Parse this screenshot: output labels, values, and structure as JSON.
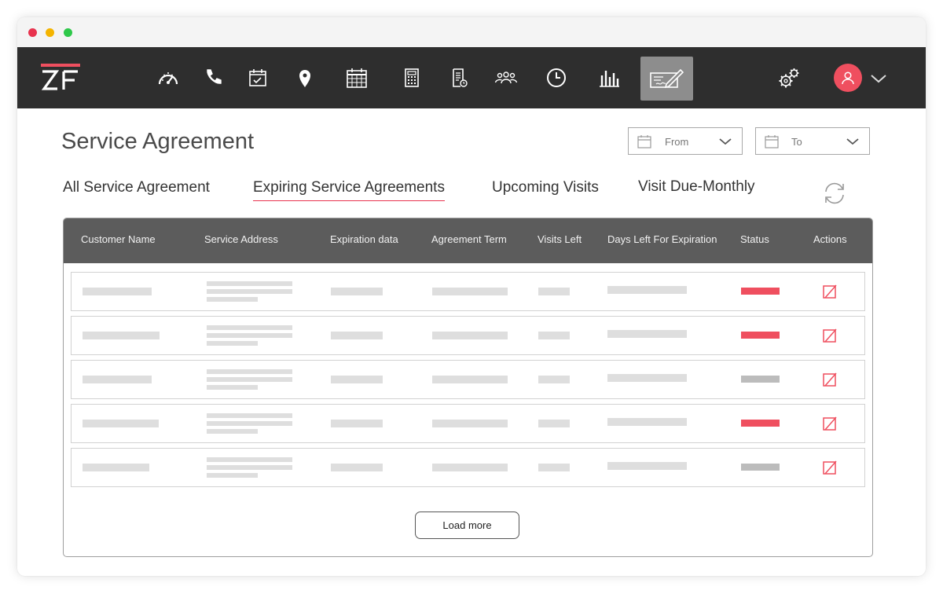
{
  "app": {
    "logo_text": "ZF"
  },
  "nav": {
    "icons": [
      "dashboard-gauge-icon",
      "phone-icon",
      "calendar-check-icon",
      "location-pin-icon",
      "calendar-grid-icon",
      "calculator-icon",
      "invoice-icon",
      "team-icon",
      "clock-icon",
      "bar-chart-icon",
      "service-agreement-icon"
    ],
    "active": "service-agreement-icon",
    "settings_icon": "gears-icon",
    "avatar_icon": "user-icon"
  },
  "page": {
    "title": "Service Agreement",
    "filters": {
      "from_label": "From",
      "to_label": "To"
    }
  },
  "tabs": [
    {
      "label": "All Service Agreement",
      "active": false
    },
    {
      "label": "Expiring Service Agreements",
      "active": true
    },
    {
      "label": "Upcoming Visits",
      "active": false
    },
    {
      "label": "Visit Due-Monthly",
      "active": false
    }
  ],
  "table": {
    "columns": [
      "Customer Name",
      "Service Address",
      "Expiration data",
      "Agreement Term",
      "Visits Left",
      "Days Left For Expiration",
      "Status",
      "Actions"
    ],
    "row_status": [
      "red",
      "red",
      "grey",
      "red",
      "grey"
    ]
  },
  "load_more_label": "Load more",
  "colors": {
    "accent": "#ef4f5f",
    "navbar": "#2e2e2e",
    "header": "#5c5c5c",
    "status_inactive": "#bcbcbc"
  }
}
